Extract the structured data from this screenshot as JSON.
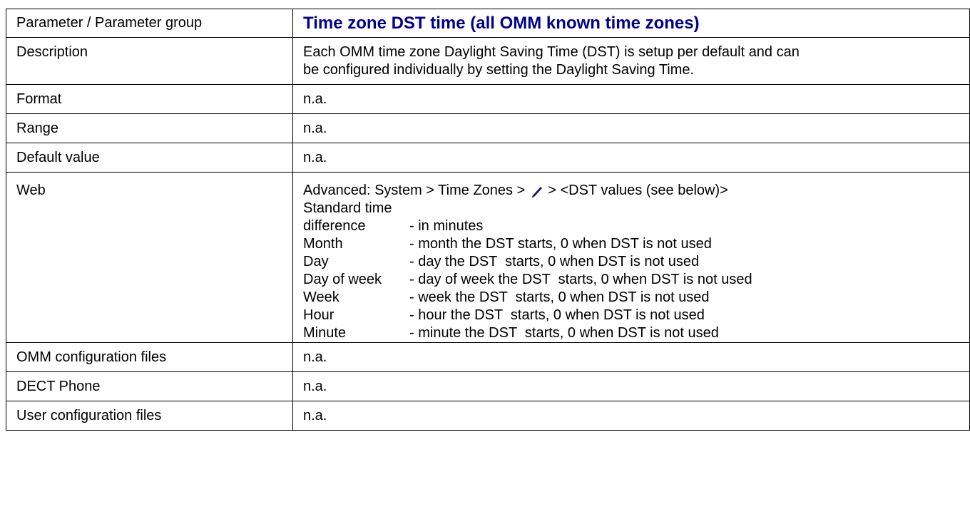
{
  "table": {
    "header": {
      "label": "Parameter / Parameter group",
      "title": "Time zone DST time (all OMM known time zones)"
    },
    "description": {
      "label": "Description",
      "line1": "Each OMM time zone Daylight Saving Time (DST) is setup per default and can",
      "line2": "be configured individually by setting the Daylight Saving Time."
    },
    "format": {
      "label": "Format",
      "value": "n.a."
    },
    "range": {
      "label": "Range",
      "value": "n.a."
    },
    "default_value": {
      "label": "Default value",
      "value": "n.a."
    },
    "web": {
      "label": "Web",
      "path_prefix": "Advanced: System > Time Zones >",
      "path_suffix": "> <DST values (see below)>",
      "edit_icon": "pencil-icon",
      "standard_time": "Standard time",
      "rows": [
        {
          "name": "difference",
          "desc": "- in minutes"
        },
        {
          "name": "Month",
          "desc": "- month the DST starts, 0 when DST is not used"
        },
        {
          "name": "Day",
          "desc": "- day the DST  starts, 0 when DST is not used"
        },
        {
          "name": "Day of week",
          "desc": "- day of week the DST  starts, 0 when DST is not used"
        },
        {
          "name": "Week",
          "desc": "- week the DST  starts, 0 when DST is not used"
        },
        {
          "name": "Hour",
          "desc": "- hour the DST  starts, 0 when DST is not used"
        },
        {
          "name": "Minute",
          "desc": "- minute the DST  starts, 0 when DST is not used"
        }
      ]
    },
    "omm_config": {
      "label": "OMM configuration files",
      "value": "n.a."
    },
    "dect_phone": {
      "label": "DECT Phone",
      "value": "n.a."
    },
    "user_config": {
      "label": "User configuration files",
      "value": "n.a."
    }
  },
  "colors": {
    "title": "#00008b",
    "border": "#000000",
    "icon": "#1a1a5e"
  }
}
